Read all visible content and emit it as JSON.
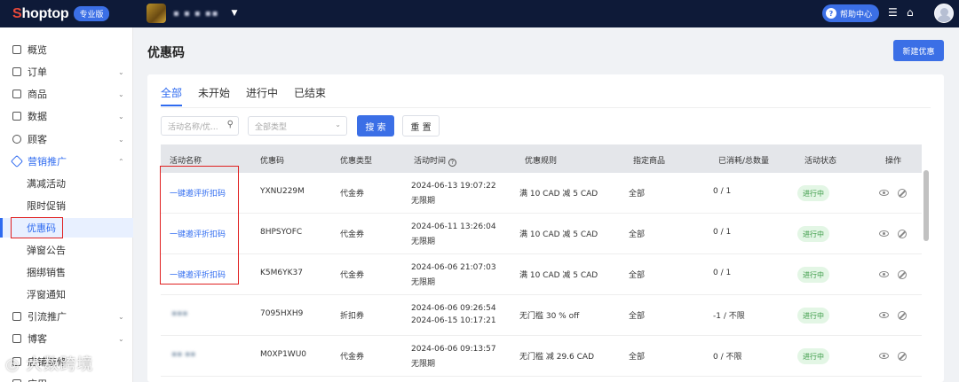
{
  "app": {
    "logo_s": "S",
    "logo_rest": "hoptop",
    "edition": "专业版",
    "store_name": "▪ ▪ ▪ ▪▪",
    "help_label": "帮助中心"
  },
  "sidebar": {
    "items": [
      {
        "label": "概览",
        "expandable": false
      },
      {
        "label": "订单",
        "expandable": true
      },
      {
        "label": "商品",
        "expandable": true
      },
      {
        "label": "数据",
        "expandable": true
      },
      {
        "label": "顾客",
        "expandable": true
      },
      {
        "label": "营销推广",
        "expandable": true,
        "expanded": true,
        "color": "#2f6bf0"
      },
      {
        "label": "引流推广",
        "expandable": true
      },
      {
        "label": "博客",
        "expandable": true
      },
      {
        "label": "店铺装修",
        "expandable": true
      },
      {
        "label": "应用",
        "expandable": true
      }
    ],
    "subitems": [
      "满减活动",
      "限时促销",
      "优惠码",
      "弹窗公告",
      "捆绑销售",
      "浮窗通知"
    ],
    "active_sub": "优惠码"
  },
  "page": {
    "title": "优惠码",
    "new_button": "新建优惠",
    "tabs": [
      "全部",
      "未开始",
      "进行中",
      "已结束"
    ],
    "active_tab": "全部",
    "search_placeholder": "活动名称/优...",
    "type_placeholder": "全部类型",
    "search_button": "搜 索",
    "reset_button": "重 置"
  },
  "table": {
    "columns": [
      "活动名称",
      "优惠码",
      "优惠类型",
      "活动时间",
      "优惠规则",
      "指定商品",
      "已消耗/总数量",
      "活动状态",
      "操作"
    ],
    "rows": [
      {
        "name": "一键邀评折扣码",
        "code": "YXNU229M",
        "type": "代金券",
        "time1": "2024-06-13 19:07:22",
        "time2": "无限期",
        "rule": "满 10 CAD 减 5 CAD",
        "products": "全部",
        "usage": "0 / 1",
        "status": "进行中",
        "name_blurred": false
      },
      {
        "name": "一键邀评折扣码",
        "code": "8HPSYOFC",
        "type": "代金券",
        "time1": "2024-06-11 13:26:04",
        "time2": "无限期",
        "rule": "满 10 CAD 减 5 CAD",
        "products": "全部",
        "usage": "0 / 1",
        "status": "进行中",
        "name_blurred": false
      },
      {
        "name": "一键邀评折扣码",
        "code": "K5M6YK37",
        "type": "代金券",
        "time1": "2024-06-06 21:07:03",
        "time2": "无限期",
        "rule": "满 10 CAD 减 5 CAD",
        "products": "全部",
        "usage": "0 / 1",
        "status": "进行中",
        "name_blurred": false
      },
      {
        "name": "▪▪▪",
        "code": "7095HXH9",
        "type": "折扣券",
        "time1": "2024-06-06 09:26:54",
        "time2": "2024-06-15 10:17:21",
        "rule": "无门槛 30 % off",
        "products": "全部",
        "usage": "-1 / 不限",
        "status": "进行中",
        "name_blurred": true
      },
      {
        "name": "▪▪ ▪▪",
        "code": "M0XP1WU0",
        "type": "代金券",
        "time1": "2024-06-06 09:13:57",
        "time2": "无限期",
        "rule": "无门槛 减 29.6 CAD",
        "products": "全部",
        "usage": "0 / 不限",
        "status": "进行中",
        "name_blurred": true
      }
    ]
  },
  "watermark": "◎ 大数跨境",
  "colors": {
    "accent": "#2f6bf0",
    "topbar": "#0e1a38",
    "status_green": "#3a9a45",
    "highlight_red": "#e02020"
  }
}
